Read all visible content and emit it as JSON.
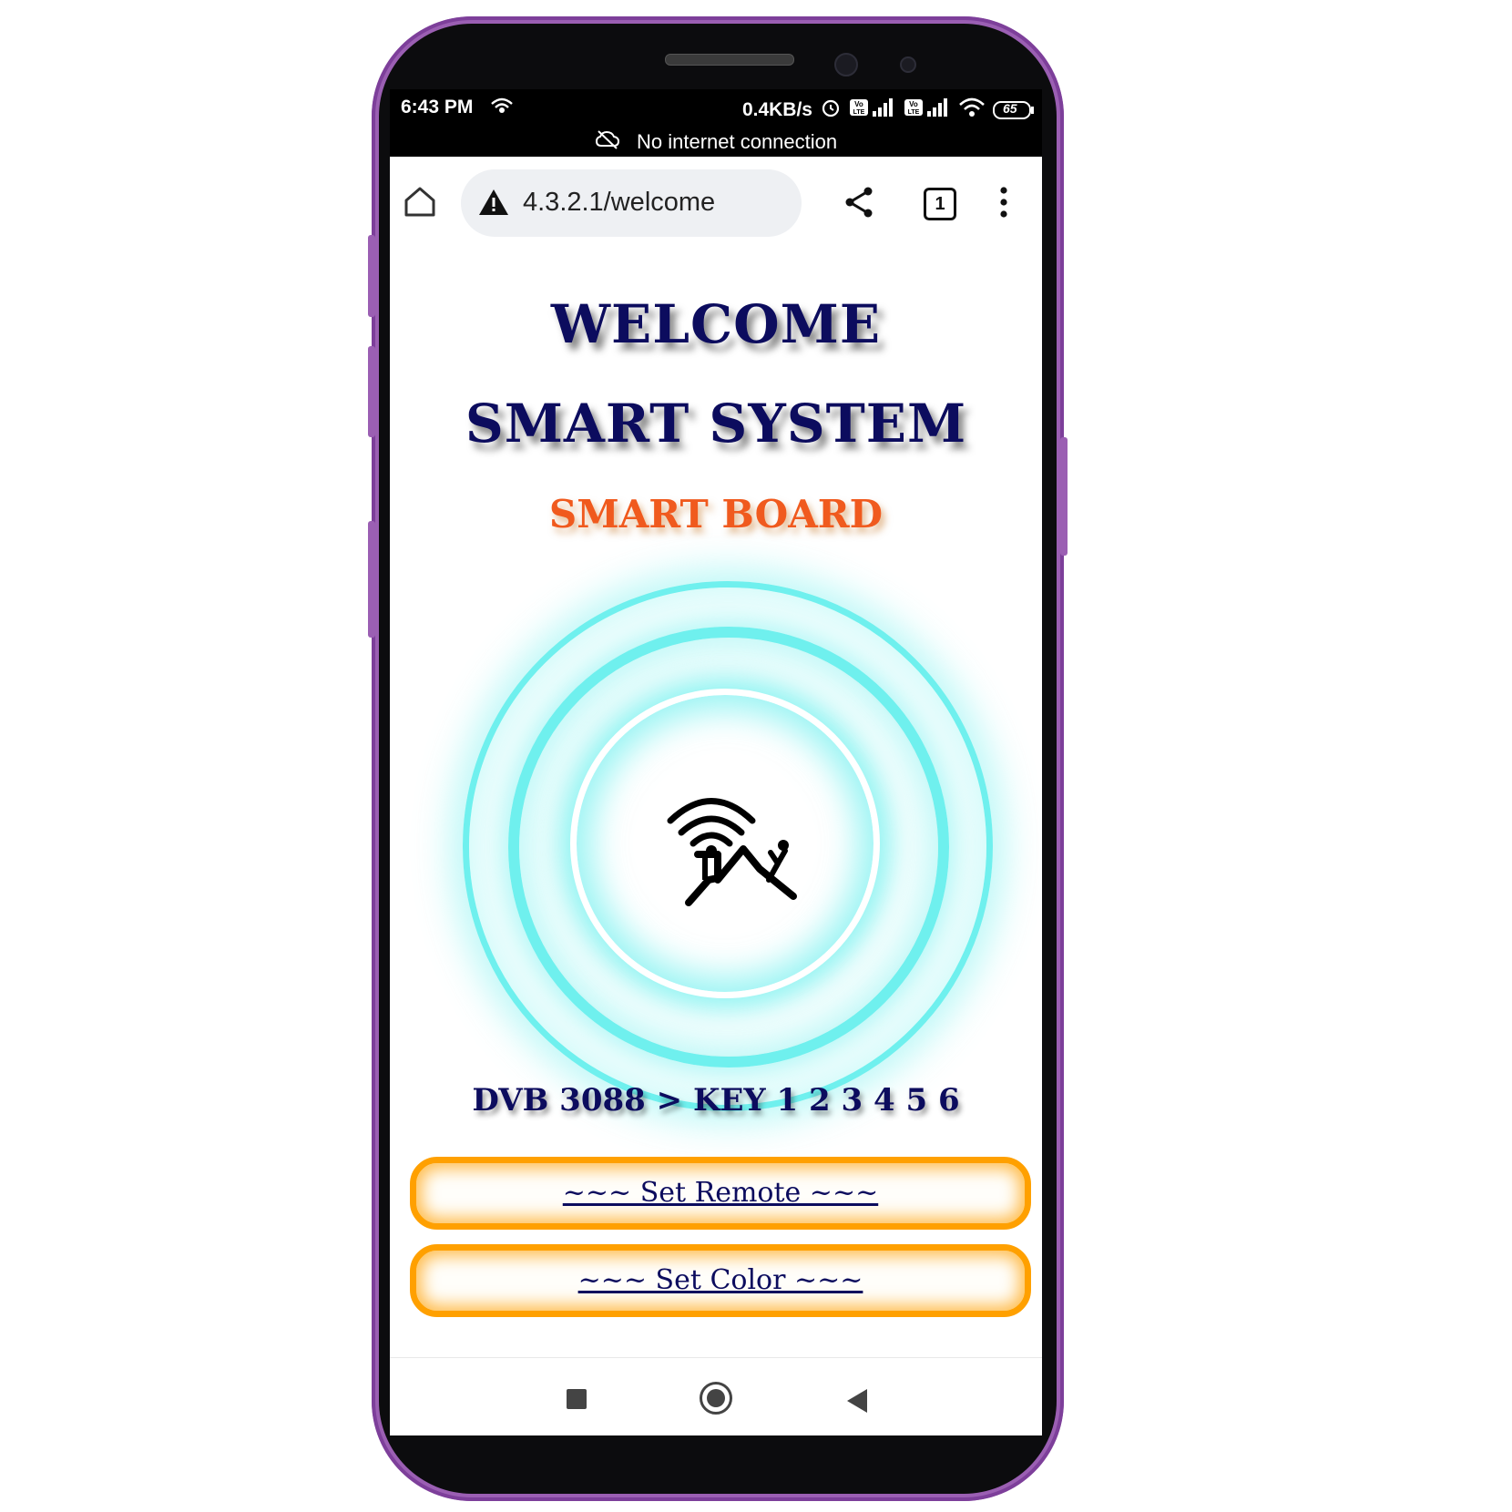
{
  "status_bar": {
    "time": "6:43 PM",
    "network_speed": "0.4KB/s",
    "sim1_label": "Vo LTE",
    "sim2_label": "Vo LTE",
    "battery": "65"
  },
  "notice": {
    "text": "No internet connection",
    "icon": "cloud-off-icon"
  },
  "browser": {
    "url": "4.3.2.1/welcome",
    "tab_count": "1",
    "icons": [
      "home-icon",
      "warning-icon",
      "share-icon",
      "tabs-icon",
      "more-vert-icon"
    ]
  },
  "page": {
    "title_line1": "WELCOME",
    "title_line2": "SMART SYSTEM",
    "subtitle": "SMART BOARD",
    "info_line": "DVB 3088 > KEY 1 2 3 4 5 6",
    "buttons": [
      {
        "label": "~~~ Set Remote ~~~"
      },
      {
        "label": "~~~ Set Color ~~~"
      }
    ],
    "logo_icon": "wifi-figures-logo-icon"
  },
  "colors": {
    "title": "#0c0c5e",
    "subtitle": "#f05a1e",
    "ring_glow": "#6ff0ee",
    "button_border": "#ffa000",
    "phone_frame": "#9b5fb3"
  },
  "nav_bar": {
    "icons": [
      "recents-square-icon",
      "home-circle-icon",
      "back-triangle-icon"
    ]
  }
}
